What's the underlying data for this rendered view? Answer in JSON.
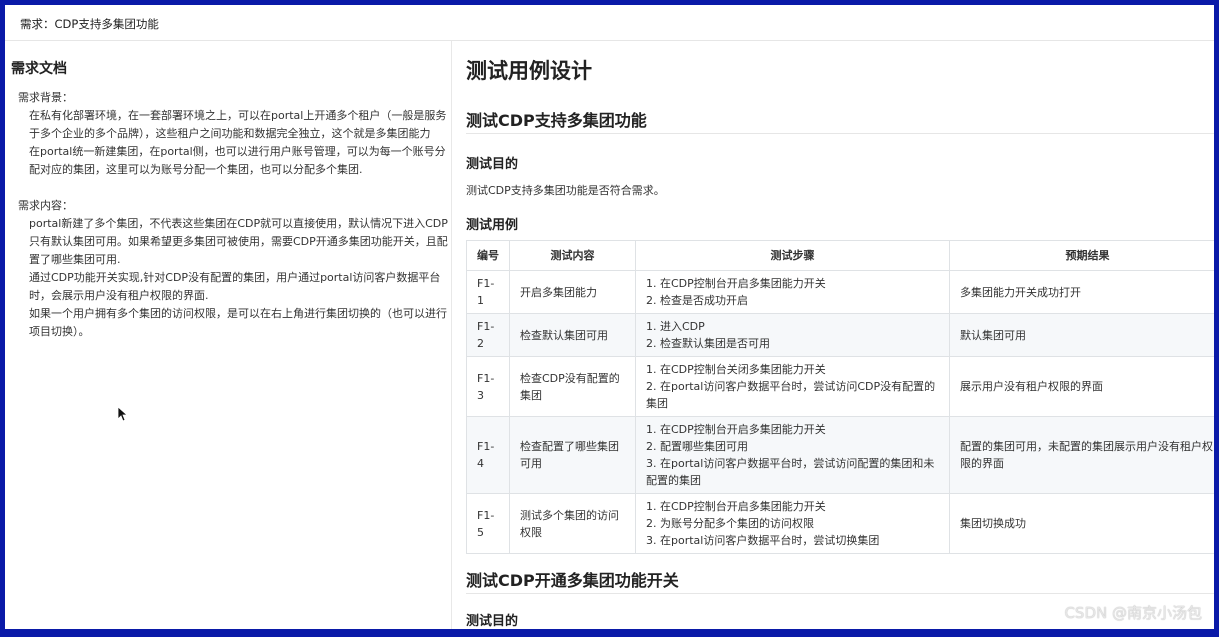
{
  "window": {
    "title": "需求：CDP支持多集团功能"
  },
  "left": {
    "heading": "需求文档",
    "background_label": "需求背景：",
    "background_p1": "在私有化部署环境，在一套部署环境之上，可以在portal上开通多个租户（一般是服务于多个企业的多个品牌），这些租户之间功能和数据完全独立，这个就是多集团能力",
    "background_p2": "在portal统一新建集团，在portal侧，也可以进行用户账号管理，可以为每一个账号分配对应的集团，这里可以为账号分配一个集团，也可以分配多个集团.",
    "content_label": "需求内容：",
    "content_p1": "portal新建了多个集团，不代表这些集团在CDP就可以直接使用，默认情况下进入CDP只有默认集团可用。如果希望更多集团可被使用，需要CDP开通多集团功能开关，且配置了哪些集团可用.",
    "content_p2": "通过CDP功能开关实现,针对CDP没有配置的集团，用户通过portal访问客户数据平台时，会展示用户没有租户权限的界面.",
    "content_p3": "如果一个用户拥有多个集团的访问权限，是可以在右上角进行集团切换的（也可以进行项目切换）。"
  },
  "right": {
    "h1": "测试用例设计",
    "section1_title": "测试CDP支持多集团功能",
    "purpose_heading": "测试目的",
    "purpose_text": "测试CDP支持多集团功能是否符合需求。",
    "cases_heading": "测试用例",
    "table": {
      "headers": [
        "编号",
        "测试内容",
        "测试步骤",
        "预期结果"
      ],
      "rows": [
        {
          "id": "F1-1",
          "content": "开启多集团能力",
          "steps": [
            "1. 在CDP控制台开启多集团能力开关",
            "2. 检查是否成功开启"
          ],
          "expected": "多集团能力开关成功打开"
        },
        {
          "id": "F1-2",
          "content": "检查默认集团可用",
          "steps": [
            "1. 进入CDP",
            "2. 检查默认集团是否可用"
          ],
          "expected": "默认集团可用"
        },
        {
          "id": "F1-3",
          "content": "检查CDP没有配置的集团",
          "steps": [
            "1. 在CDP控制台关闭多集团能力开关",
            "2. 在portal访问客户数据平台时，尝试访问CDP没有配置的集团"
          ],
          "expected": "展示用户没有租户权限的界面"
        },
        {
          "id": "F1-4",
          "content": "检查配置了哪些集团可用",
          "steps": [
            "1. 在CDP控制台开启多集团能力开关",
            "2. 配置哪些集团可用",
            "3. 在portal访问客户数据平台时，尝试访问配置的集团和未配置的集团"
          ],
          "expected": "配置的集团可用，未配置的集团展示用户没有租户权限的界面"
        },
        {
          "id": "F1-5",
          "content": "测试多个集团的访问权限",
          "steps": [
            "1. 在CDP控制台开启多集团能力开关",
            "2. 为账号分配多个集团的访问权限",
            "3. 在portal访问客户数据平台时，尝试切换集团"
          ],
          "expected": "集团切换成功"
        }
      ]
    },
    "section2_title": "测试CDP开通多集团功能开关",
    "section2_purpose_heading": "测试目的"
  },
  "watermark": "CSDN @南京小汤包"
}
